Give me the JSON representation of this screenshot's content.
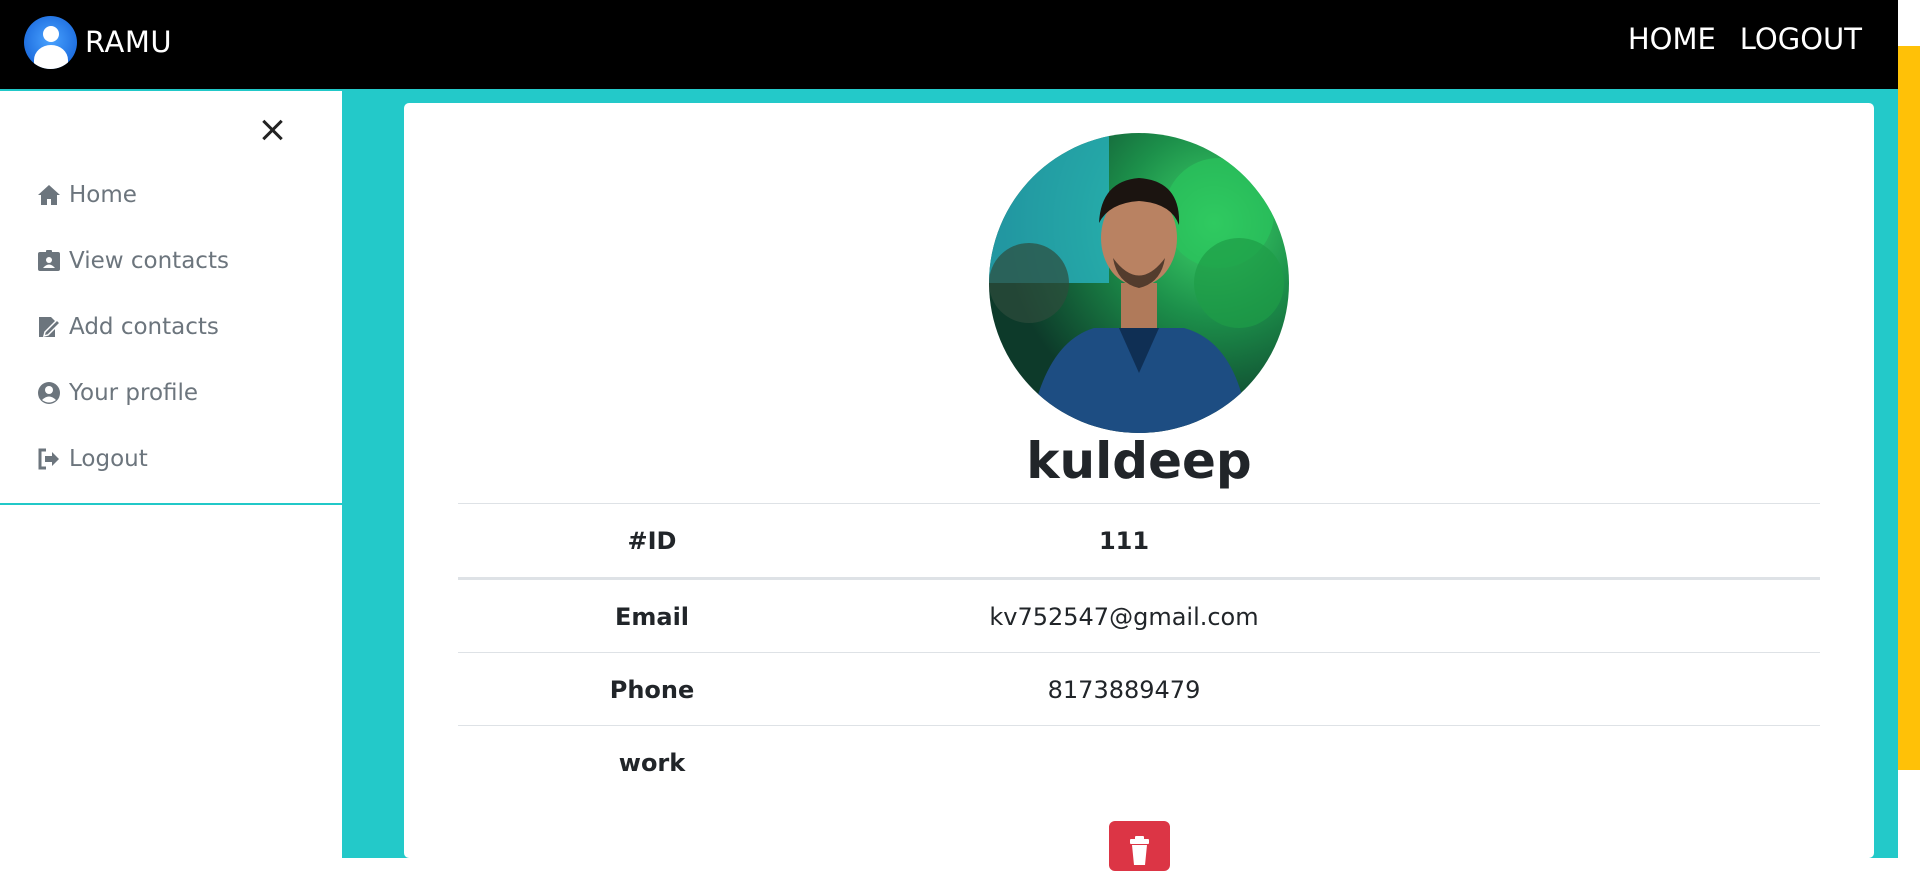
{
  "navbar": {
    "brand_name": "RAMU",
    "links": [
      "HOME",
      "LOGOUT"
    ],
    "background": "#000000"
  },
  "sidebar": {
    "items": [
      {
        "label": "Home",
        "icon": "home-icon"
      },
      {
        "label": "View contacts",
        "icon": "id-badge-icon"
      },
      {
        "label": "Add contacts",
        "icon": "edit-icon"
      },
      {
        "label": "Your profile",
        "icon": "user-circle-icon"
      },
      {
        "label": "Logout",
        "icon": "sign-out-icon"
      }
    ],
    "close_icon": "close-icon"
  },
  "profile": {
    "name": "kuldeep",
    "rows": [
      {
        "label": "#ID",
        "value": "111"
      },
      {
        "label": "Email",
        "value": "kv752547@gmail.com"
      },
      {
        "label": "Phone",
        "value": "8173889479"
      },
      {
        "label": "work",
        "value": ""
      }
    ],
    "delete_icon": "trash-icon"
  },
  "colors": {
    "accent_teal": "#23c9c9",
    "accent_yellow": "#ffc107",
    "danger": "#dc3545",
    "sidebar_text": "#6c757d"
  }
}
